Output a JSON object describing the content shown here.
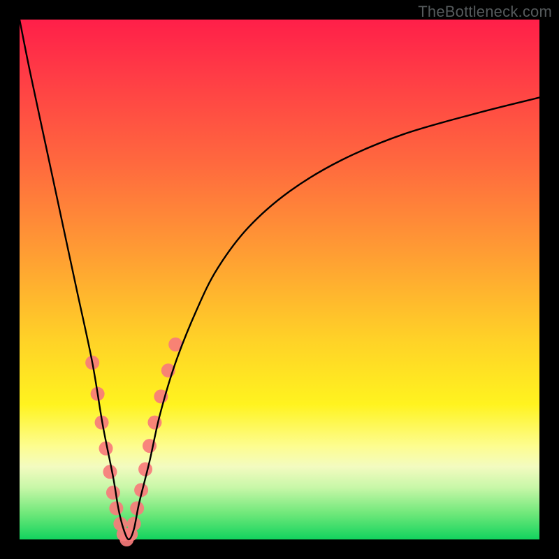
{
  "watermark": {
    "text": "TheBottleneck.com"
  },
  "chart_data": {
    "type": "line",
    "title": "",
    "xlabel": "",
    "ylabel": "",
    "xlim": [
      0,
      100
    ],
    "ylim": [
      0,
      100
    ],
    "grid": false,
    "legend": false,
    "background_gradient": {
      "direction": "vertical",
      "stops": [
        {
          "pos": 0.0,
          "color": "#ff1f49"
        },
        {
          "pos": 0.28,
          "color": "#ff6a3e"
        },
        {
          "pos": 0.62,
          "color": "#ffd327"
        },
        {
          "pos": 0.82,
          "color": "#fdfd8f"
        },
        {
          "pos": 0.95,
          "color": "#6fe87a"
        },
        {
          "pos": 1.0,
          "color": "#12d35e"
        }
      ]
    },
    "series": [
      {
        "name": "bottleneck-curve",
        "stroke": "#000000",
        "x": [
          0,
          2,
          5,
          8,
          11,
          14,
          16,
          18,
          19,
          20,
          21,
          22,
          23,
          25,
          27,
          30,
          34,
          38,
          44,
          52,
          62,
          74,
          88,
          100
        ],
        "values": [
          100,
          90,
          76,
          62,
          48,
          34,
          22,
          12,
          6,
          2,
          0,
          2,
          7,
          15,
          24,
          34,
          44,
          52,
          60,
          67,
          73,
          78,
          82,
          85
        ]
      }
    ],
    "markers": {
      "name": "highlighted-points",
      "color": "#f77b7b",
      "radius_px": 10,
      "x": [
        14.0,
        15.0,
        15.8,
        16.6,
        17.4,
        18.0,
        18.6,
        19.4,
        20.0,
        20.6,
        21.4,
        22.0,
        22.6,
        23.4,
        24.2,
        25.0,
        26.0,
        27.2,
        28.6,
        30.0
      ],
      "values": [
        34.0,
        28.0,
        22.5,
        17.5,
        13.0,
        9.0,
        6.0,
        3.0,
        1.0,
        0.0,
        1.0,
        3.0,
        6.0,
        9.5,
        13.5,
        18.0,
        22.5,
        27.5,
        32.5,
        37.5
      ]
    }
  }
}
